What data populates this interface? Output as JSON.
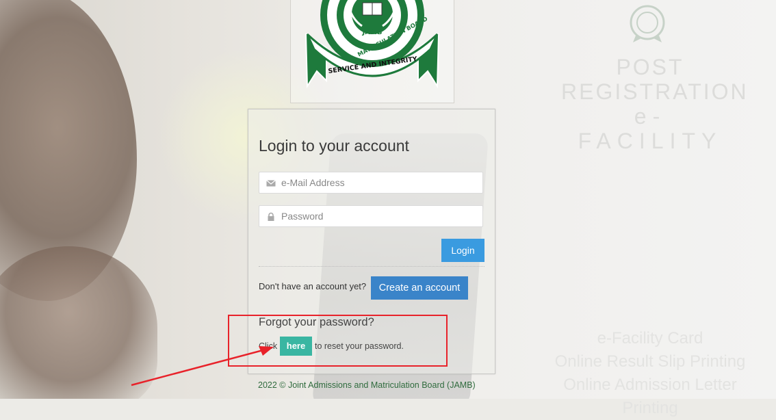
{
  "logo": {
    "top_text": "JAMB",
    "ring_text": "MATRICULATION BOARD",
    "ribbon_text": "SERVICE AND INTEGRITY"
  },
  "watermark": {
    "title_line1": "POST",
    "title_line2": "REGISTRATION",
    "title_line3": "e- FACILITY",
    "links": [
      "e-Facility Card",
      "Online Result Slip Printing",
      "Online Admission Letter Printing"
    ]
  },
  "login": {
    "heading": "Login to your account",
    "email_placeholder": "e-Mail Address",
    "password_placeholder": "Password",
    "login_button": "Login",
    "no_account_text": "Don't have an account yet?",
    "create_button": "Create an account",
    "forgot_heading": "Forgot your password?",
    "click_text": "Click",
    "here_button": "here",
    "reset_text": "to reset your password."
  },
  "footer": {
    "copyright": "2022 © Joint Admissions and Matriculation Board (JAMB)"
  },
  "colors": {
    "primary_blue": "#3a9be0",
    "create_blue": "#3a84c9",
    "teal": "#3ab6a2",
    "jamb_green": "#1e7a3c",
    "annotation_red": "#e8222a"
  },
  "icons": {
    "email": "envelope-icon",
    "password": "lock-icon"
  }
}
